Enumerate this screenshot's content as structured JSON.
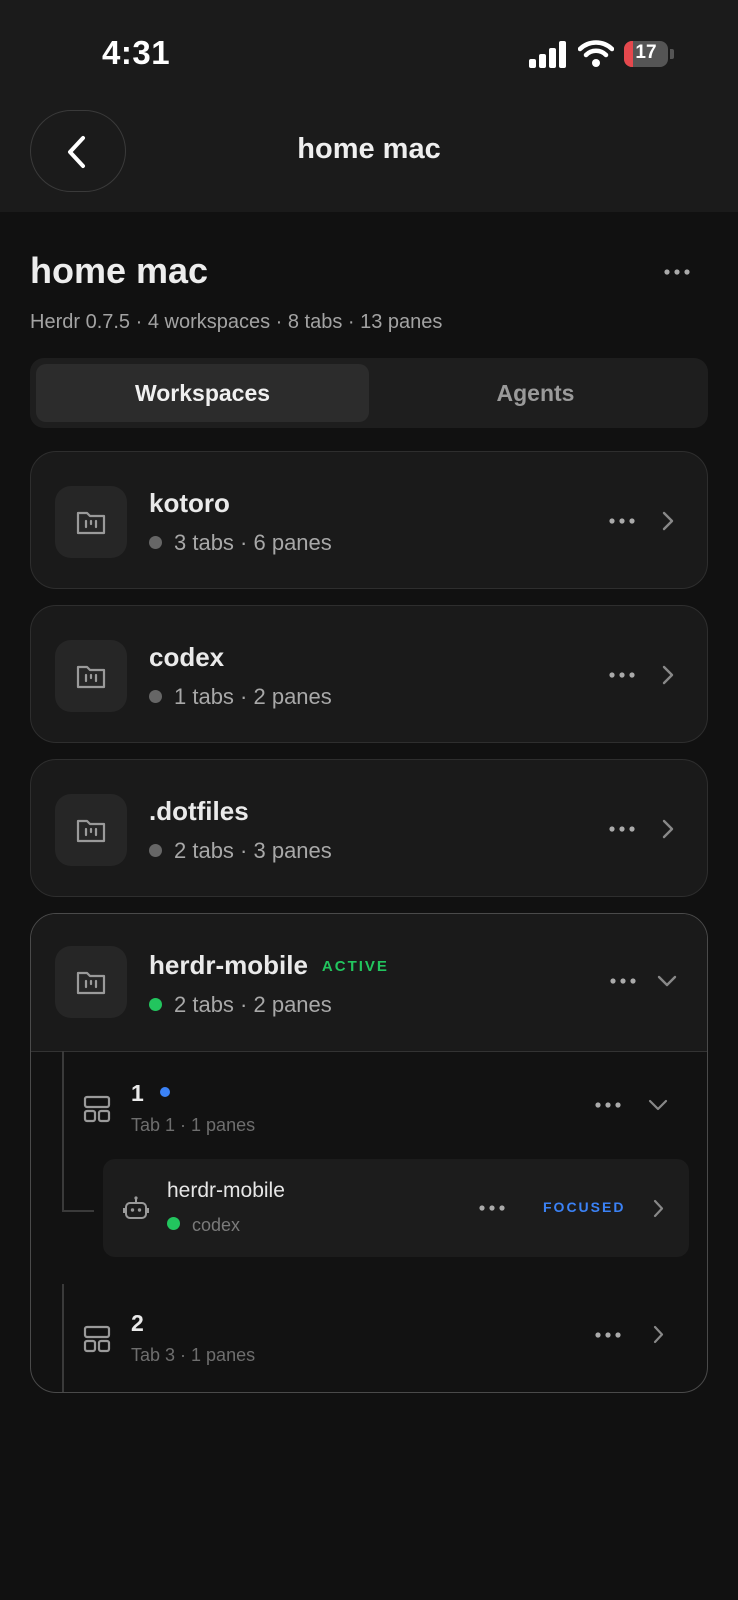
{
  "status_bar": {
    "time": "4:31",
    "battery_level": "17"
  },
  "header": {
    "title": "home mac"
  },
  "page": {
    "title": "home mac",
    "subtitle": "Herdr 0.7.5 · 4 workspaces · 8 tabs · 13 panes"
  },
  "segmented": {
    "workspaces_label": "Workspaces",
    "agents_label": "Agents"
  },
  "workspaces": [
    {
      "name": "kotoro",
      "meta": "3 tabs · 6 panes"
    },
    {
      "name": "codex",
      "meta": "1 tabs · 2 panes"
    },
    {
      "name": ".dotfiles",
      "meta": "2 tabs · 3 panes"
    }
  ],
  "active_workspace": {
    "name": "herdr-mobile",
    "badge": "ACTIVE",
    "meta": "2 tabs · 2 panes",
    "tabs": [
      {
        "number": "1",
        "subtitle": "Tab 1 · 1 panes",
        "pane": {
          "name": "herdr-mobile",
          "agent": "codex",
          "badge": "FOCUSED"
        }
      },
      {
        "number": "2",
        "subtitle": "Tab 3 · 1 panes"
      }
    ]
  },
  "colors": {
    "active_green": "#22c55e",
    "focus_blue": "#3b82f6",
    "battery_red": "#e5484d"
  }
}
